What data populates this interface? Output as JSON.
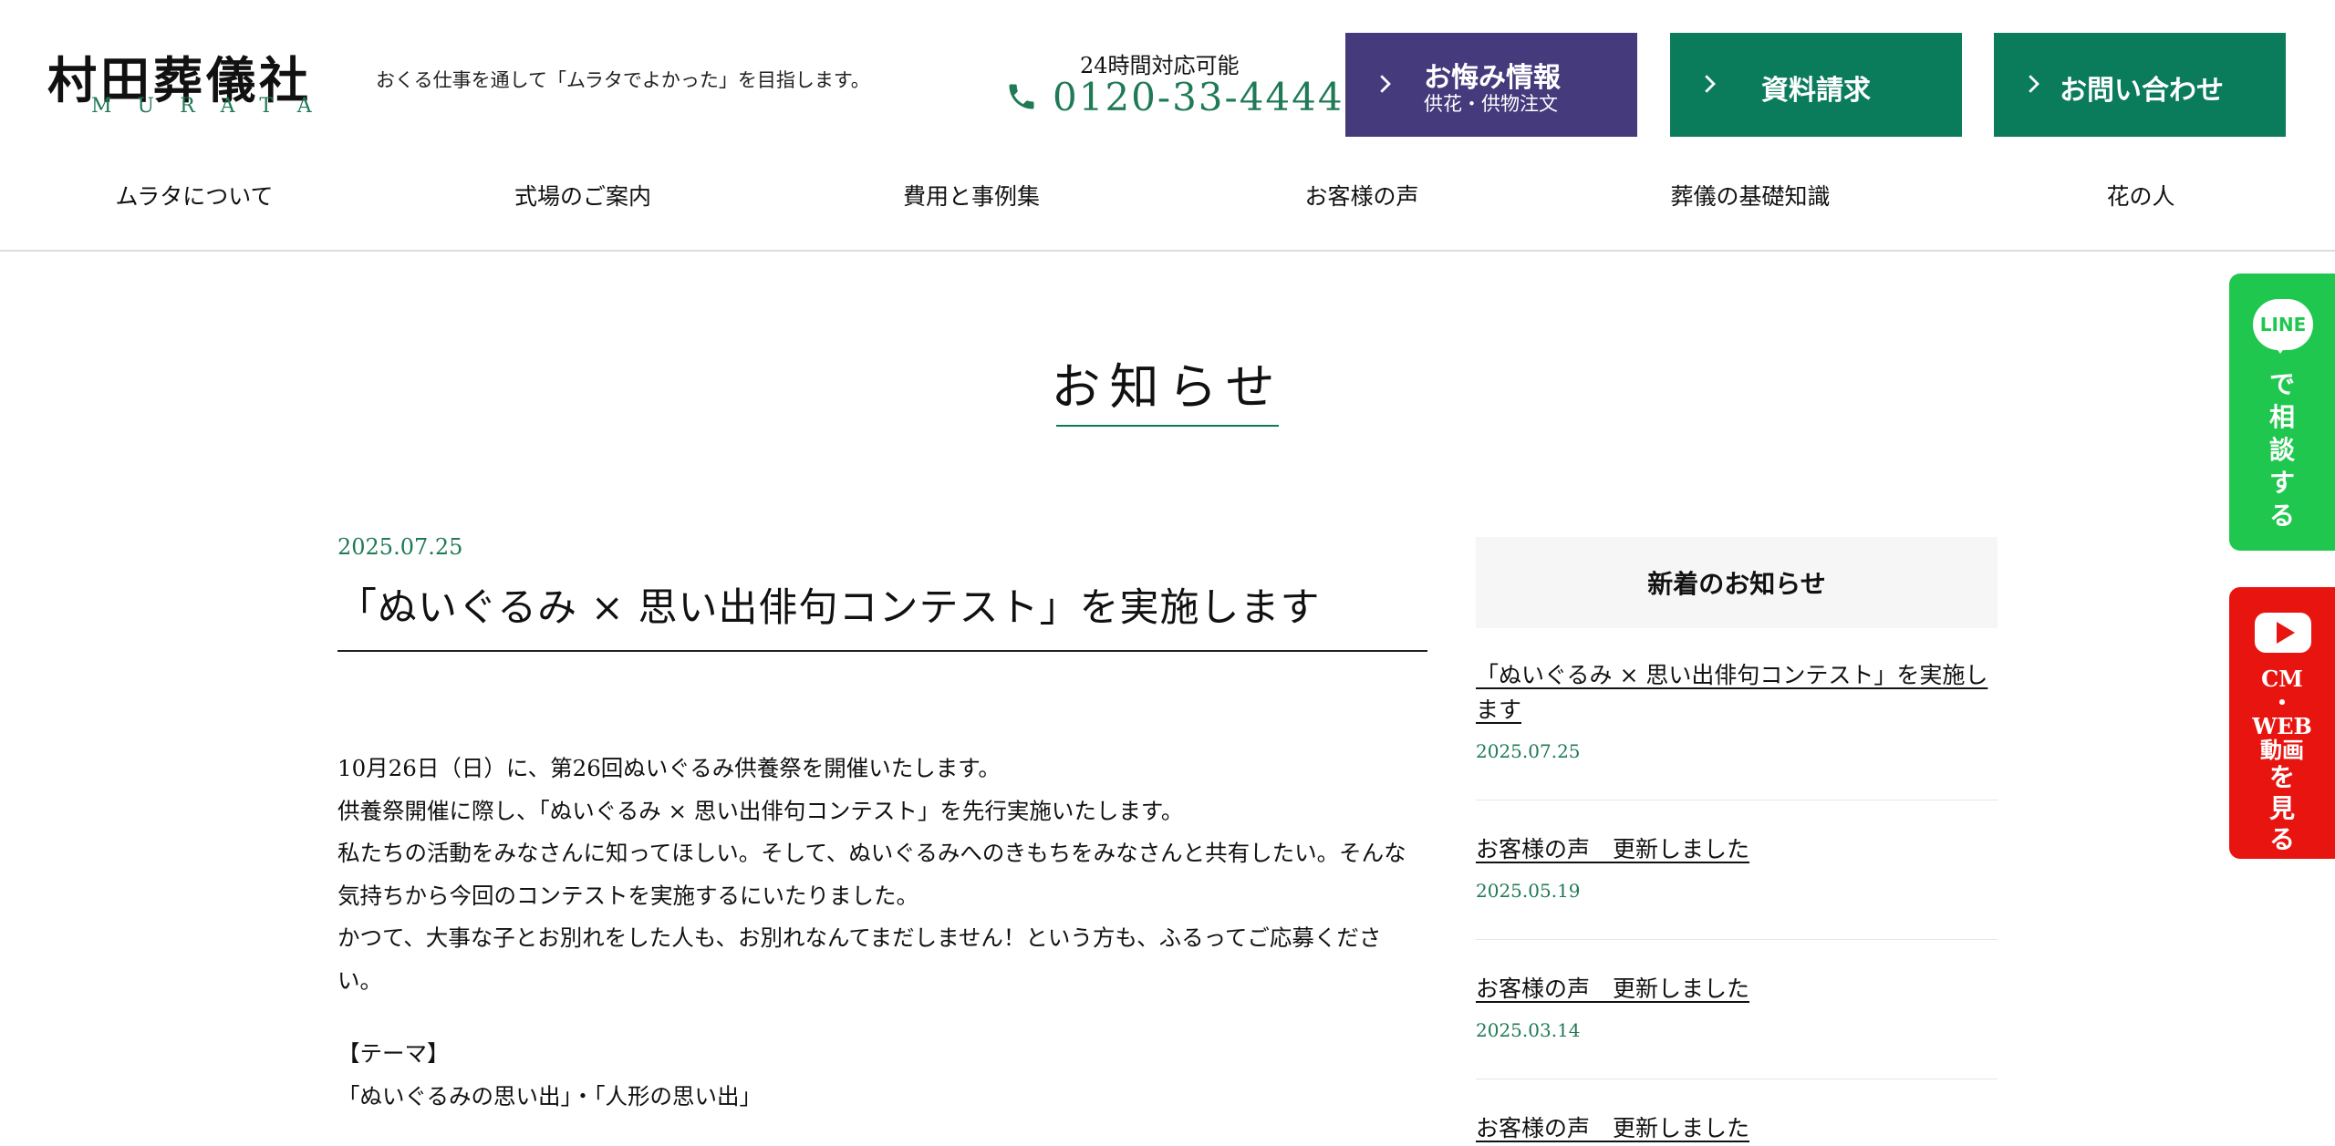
{
  "header": {
    "logo": {
      "main": "村田葬儀社",
      "sub": "MURATA"
    },
    "tagline": "おくる仕事を通して「ムラタでよかった」を目指します。",
    "phone": {
      "label": "24時間対応可能",
      "number": "0120-33-4444"
    },
    "buttons": {
      "kuyami": {
        "label": "お悔み情報",
        "sub": "供花・供物注文"
      },
      "shiryo": {
        "label": "資料請求"
      },
      "toiawase": {
        "label": "お問い合わせ"
      }
    },
    "nav": [
      "ムラタについて",
      "式場のご案内",
      "費用と事例集",
      "お客様の声",
      "葬儀の基礎知識",
      "花の人"
    ]
  },
  "page": {
    "title": "お知らせ"
  },
  "article": {
    "date": "2025.07.25",
    "title": "「ぬいぐるみ × 思い出俳句コンテスト」を実施します",
    "paragraphs": [
      "10月26日（日）に、第26回ぬいぐるみ供養祭を開催いたします。",
      "供養祭開催に際し、「ぬいぐるみ × 思い出俳句コンテスト」を先行実施いたします。",
      "私たちの活動をみなさんに知ってほしい。そして、ぬいぐるみへのきもちをみなさんと共有したい。そんな",
      "気持ちから今回のコンテストを実施するにいたりました。",
      "かつて、大事な子とお別れをした人も、お別れなんてまだしません！という方も、ふるってご応募くださ",
      "い。"
    ],
    "theme_heading": "【テーマ】",
    "theme_text": "「ぬいぐるみの思い出」・「人形の思い出」"
  },
  "sidebar": {
    "heading": "新着のお知らせ",
    "items": [
      {
        "title_line1": "「ぬいぐるみ × 思い出俳句コンテスト」を実施し",
        "title_line2": "ます",
        "date": "2025.07.25"
      },
      {
        "title": "お客様の声　更新しました",
        "date": "2025.05.19"
      },
      {
        "title": "お客様の声　更新しました",
        "date": "2025.03.14"
      },
      {
        "title": "お客様の声　更新しました"
      }
    ]
  },
  "floating": {
    "line": {
      "icon_text": "LINE",
      "chars": [
        "で",
        "相",
        "談",
        "す",
        "る"
      ]
    },
    "youtube": {
      "chars": [
        "CM",
        "・",
        "WEB",
        "動画",
        "を",
        "見",
        "る"
      ]
    }
  },
  "colors": {
    "accent_green": "#0a7b5b",
    "purple": "#453a7c",
    "line_green": "#1fc74e",
    "youtube_red": "#e8140f"
  }
}
